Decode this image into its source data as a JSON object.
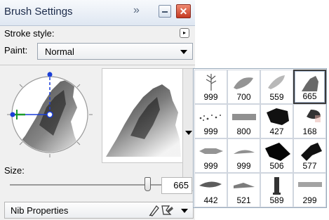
{
  "panel": {
    "title": "Brush Settings",
    "stroke_style_label": "Stroke style:",
    "paint_label": "Paint:",
    "paint_value": "Normal",
    "size_label": "Size:",
    "size_value": "665",
    "size_fraction": 0.9,
    "nib_label": "Nib Properties"
  },
  "icons": {
    "overflow": "double-chevron-icon",
    "minimize": "minimize-icon",
    "close": "close-icon",
    "nib_tools": "pen-nib-icons"
  },
  "brush_grid": [
    {
      "size": "999",
      "selected": false
    },
    {
      "size": "700",
      "selected": false
    },
    {
      "size": "559",
      "selected": false
    },
    {
      "size": "665",
      "selected": true
    },
    {
      "size": "999",
      "selected": false
    },
    {
      "size": "800",
      "selected": false
    },
    {
      "size": "427",
      "selected": false
    },
    {
      "size": "168",
      "selected": false
    },
    {
      "size": "999",
      "selected": false
    },
    {
      "size": "999",
      "selected": false
    },
    {
      "size": "506",
      "selected": false
    },
    {
      "size": "577",
      "selected": false
    },
    {
      "size": "442",
      "selected": false
    },
    {
      "size": "521",
      "selected": false
    },
    {
      "size": "589",
      "selected": false
    },
    {
      "size": "299",
      "selected": false
    }
  ],
  "colors": {
    "accent_blue": "#1a3fd8",
    "accent_green": "#1a9a2a",
    "close_red": "#c43a22"
  }
}
